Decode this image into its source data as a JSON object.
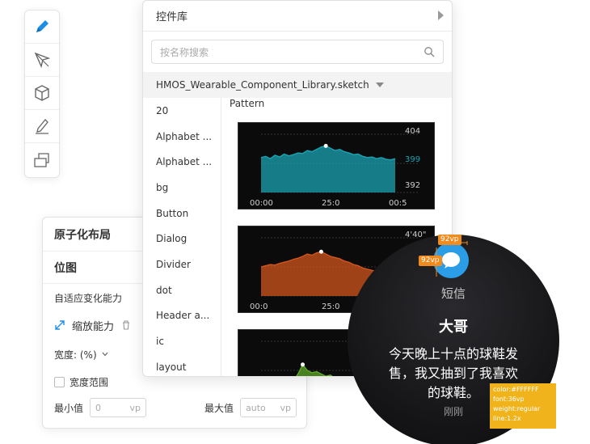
{
  "lib": {
    "title": "控件库",
    "search_placeholder": "按名称搜索",
    "file_name": "HMOS_Wearable_Component_Library.sketch",
    "items": [
      "20",
      "Alphabet ...",
      "Alphabet ...",
      "bg",
      "Button",
      "Dialog",
      "Divider",
      "dot",
      "Header a...",
      "ic",
      "layout"
    ],
    "preview_title": "Pattern"
  },
  "charts": [
    {
      "type": "area",
      "color": "#1aa3b3",
      "x_ticks": [
        "00:00",
        "25:0",
        "00:5"
      ],
      "y_labels": [
        "404",
        "399",
        "392"
      ],
      "highlight_label": "399",
      "values": [
        60,
        62,
        58,
        64,
        61,
        66,
        63,
        65,
        68,
        67,
        72,
        70,
        74,
        78,
        80,
        76,
        72,
        74,
        70,
        68,
        65,
        66,
        62,
        60,
        61,
        58,
        60,
        57,
        56,
        58
      ]
    },
    {
      "type": "area",
      "color": "#d2551e",
      "x_ticks": [
        "00:0",
        "25:0",
        ""
      ],
      "y_labels": [
        "4'40\""
      ],
      "values": [
        50,
        52,
        54,
        53,
        56,
        58,
        60,
        63,
        65,
        68,
        72,
        70,
        74,
        76,
        72,
        68,
        66,
        64,
        60,
        58,
        54,
        52,
        48,
        46,
        44,
        42,
        40,
        38,
        36,
        34
      ]
    },
    {
      "type": "area",
      "color": "#5fa82a",
      "x_ticks": [],
      "y_labels": [],
      "values": [
        20,
        22,
        24,
        23,
        26,
        30,
        28,
        32,
        44,
        60,
        50,
        46,
        48,
        44,
        40,
        42,
        36,
        34,
        32,
        30,
        28,
        26,
        24,
        22,
        20,
        21,
        19,
        20,
        18,
        17
      ]
    }
  ],
  "props": {
    "title": "原子化布局",
    "section": "位图",
    "adapt_label": "自适应变化能力",
    "scale_label": "缩放能力",
    "width_label": "宽度: (%)",
    "range_label": "宽度范围",
    "min_label": "最小值",
    "min_value": "0",
    "unit": "vp",
    "max_label": "最大值",
    "max_value": "auto"
  },
  "watch": {
    "app_name": "短信",
    "sender": "大哥",
    "message_line1": "今天晚上十点的球鞋发",
    "message_line2": "售，我又抽到了我喜欢",
    "message_line3": "的球鞋。",
    "time": "刚刚",
    "dim_tag_h": "92vp",
    "dim_tag_v": "92vp",
    "tooltip_lines": [
      "color:#FFFFFF",
      "font:36vp",
      "weight:regular",
      "line:1.2x"
    ]
  },
  "colors": {
    "accent": "#2a9de6",
    "tag": "#f08b1f",
    "tooltip": "#f1b31c"
  }
}
